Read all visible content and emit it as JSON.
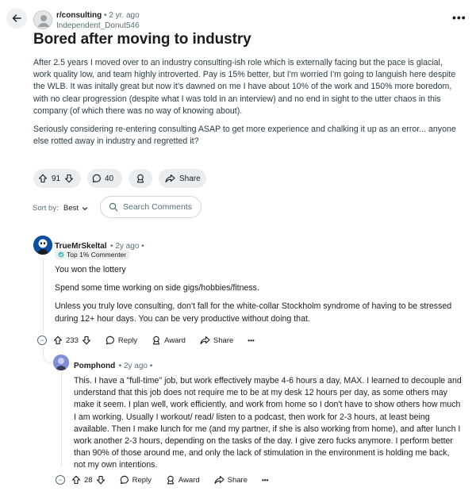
{
  "header": {
    "subreddit": "r/consulting",
    "separator": "•",
    "age": "2 yr. ago",
    "author": "Independent_Donut546",
    "more": "•••"
  },
  "post": {
    "title": "Bored after moving to industry",
    "paragraphs": [
      "After 2.5 years I moved over to an industry consulting-ish role which is externally facing but the pace is glacial, work quality low, and team highly introverted. Pay is 15% better, but I'm worried I'm going to languish here despite the WLB. It was initally great but now it's dawned on me I have about 10% of the work and 150% more boredom, with no clear progression (despite what I was told in an interview) and no end in sight to the utter chaos in this company (of which there was no way of knowing about).",
      "Seriously considering re-entering consulting ASAP to get more experience and chalking it up as an error... anyone else rotted away in industry and regretted it?"
    ],
    "votes": "91",
    "comments": "40",
    "share_label": "Share"
  },
  "sort": {
    "label": "Sort by:",
    "value": "Best",
    "search_placeholder": "Search Comments"
  },
  "comments": [
    {
      "author": "TrueMrSkeltal",
      "age": "• 2y ago •",
      "flair": "Top 1% Commenter",
      "paragraphs": [
        "You won the lottery",
        "Spend some time working on side gigs/hobbies/fitness.",
        "Unless you truly love consulting, don't fall for the white-collar Stockholm syndrome of having to be stressed during 12+ hour days. You can be very productive without doing that."
      ],
      "votes": "233",
      "reply": "Reply",
      "award": "Award",
      "share": "Share",
      "more": "•••"
    },
    {
      "author": "Pomphond",
      "age": "• 2y ago •",
      "paragraphs": [
        "This. I have a \"full-time\" job, but work effectively maybe 4-6 hours a day, MAX. I learned to decouple and understand that this job does not require me to be at my desk 12 hours per day, as some others may make it seem. I plan well, work efficiently, and work from home so I don't have to show others how much I am working. Usually I workout/ read/ listen to a podcast, then work for 2-3 hours, at least being available. Then I make lunch for me (and my partner, if she is also working from home), and after lunch I work another 2-3 hours, depending on the tasks of the day. I give zero fucks anymore. I perform better than 90% of those around me, and only the lack of stimulation in the environment is holding me back, not my own intentions."
      ],
      "votes": "28",
      "reply": "Reply",
      "award": "Award",
      "share": "Share",
      "more": "•••"
    }
  ],
  "colors": {
    "pill_bg": "#e9edef",
    "meta_text": "#576f76",
    "thread_line": "#dfe3e5"
  }
}
